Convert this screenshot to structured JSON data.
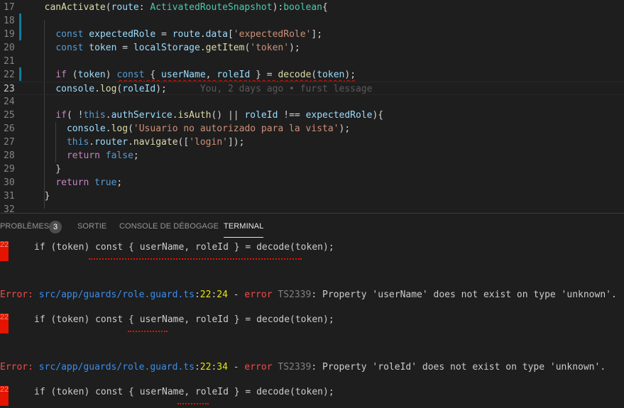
{
  "editor": {
    "lines": [
      {
        "num": "17",
        "tokens": [
          [
            "",
            "  "
          ],
          [
            "f",
            "canActivate"
          ],
          [
            "",
            "("
          ],
          [
            "v",
            "route"
          ],
          [
            "",
            ": "
          ],
          [
            "t",
            "ActivatedRouteSnapshot"
          ],
          [
            "",
            "):"
          ],
          [
            "t",
            "boolean"
          ],
          [
            "",
            "{"
          ]
        ]
      },
      {
        "num": "18",
        "tokens": []
      },
      {
        "num": "19",
        "tokens": [
          [
            "",
            "    "
          ],
          [
            "k",
            "const"
          ],
          [
            "",
            " "
          ],
          [
            "v",
            "expectedRole"
          ],
          [
            "",
            " = "
          ],
          [
            "v",
            "route"
          ],
          [
            "",
            "."
          ],
          [
            "v",
            "data"
          ],
          [
            "",
            "["
          ],
          [
            "s",
            "'expectedRole'"
          ],
          [
            "",
            "];"
          ]
        ]
      },
      {
        "num": "20",
        "tokens": [
          [
            "",
            "    "
          ],
          [
            "k",
            "const"
          ],
          [
            "",
            " "
          ],
          [
            "v",
            "token"
          ],
          [
            "",
            " = "
          ],
          [
            "v",
            "localStorage"
          ],
          [
            "",
            "."
          ],
          [
            "f",
            "getItem"
          ],
          [
            "",
            "("
          ],
          [
            "s",
            "'token'"
          ],
          [
            "",
            ");"
          ]
        ]
      },
      {
        "num": "21",
        "tokens": []
      },
      {
        "num": "22",
        "tokens": [
          [
            "",
            "    "
          ],
          [
            "kc",
            "if"
          ],
          [
            "",
            " ("
          ],
          [
            "v",
            "token"
          ],
          [
            "",
            ") "
          ],
          [
            "k sq",
            "const"
          ],
          [
            "sq",
            " { "
          ],
          [
            "v sq",
            "userName"
          ],
          [
            "sq",
            ", "
          ],
          [
            "v sq",
            "roleId"
          ],
          [
            "sq",
            " } = "
          ],
          [
            "f sq",
            "decode"
          ],
          [
            "sq",
            "("
          ],
          [
            "v sq",
            "token"
          ],
          [
            "sq",
            ");"
          ]
        ]
      },
      {
        "num": "23",
        "tokens": [
          [
            "",
            "    "
          ],
          [
            "v",
            "console"
          ],
          [
            "",
            "."
          ],
          [
            "f",
            "log"
          ],
          [
            "",
            "("
          ],
          [
            "v",
            "roleId"
          ],
          [
            "",
            ");"
          ],
          [
            "blame",
            "      You, 2 days ago • furst lessage"
          ]
        ]
      },
      {
        "num": "24",
        "tokens": []
      },
      {
        "num": "25",
        "tokens": [
          [
            "",
            "    "
          ],
          [
            "kc",
            "if"
          ],
          [
            "",
            "( !"
          ],
          [
            "k",
            "this"
          ],
          [
            "",
            "."
          ],
          [
            "v",
            "authService"
          ],
          [
            "",
            "."
          ],
          [
            "f",
            "isAuth"
          ],
          [
            "",
            "() || "
          ],
          [
            "v",
            "roleId"
          ],
          [
            "",
            " !== "
          ],
          [
            "v",
            "expectedRole"
          ],
          [
            "",
            "){"
          ]
        ]
      },
      {
        "num": "26",
        "tokens": [
          [
            "",
            "      "
          ],
          [
            "v",
            "console"
          ],
          [
            "",
            "."
          ],
          [
            "f",
            "log"
          ],
          [
            "",
            "("
          ],
          [
            "s",
            "'Usuario no autorizado para la vista'"
          ],
          [
            "",
            ");"
          ]
        ]
      },
      {
        "num": "27",
        "tokens": [
          [
            "",
            "      "
          ],
          [
            "k",
            "this"
          ],
          [
            "",
            "."
          ],
          [
            "v",
            "router"
          ],
          [
            "",
            "."
          ],
          [
            "f",
            "navigate"
          ],
          [
            "",
            "(["
          ],
          [
            "s",
            "'login'"
          ],
          [
            "",
            "]);"
          ]
        ]
      },
      {
        "num": "28",
        "tokens": [
          [
            "",
            "      "
          ],
          [
            "kc",
            "return"
          ],
          [
            "",
            " "
          ],
          [
            "k",
            "false"
          ],
          [
            "",
            ";"
          ]
        ]
      },
      {
        "num": "29",
        "tokens": [
          [
            "",
            "    }"
          ]
        ]
      },
      {
        "num": "30",
        "tokens": [
          [
            "",
            "    "
          ],
          [
            "kc",
            "return"
          ],
          [
            "",
            " "
          ],
          [
            "k",
            "true"
          ],
          [
            "",
            ";"
          ]
        ]
      },
      {
        "num": "31",
        "tokens": [
          [
            "",
            "  }"
          ]
        ]
      },
      {
        "num": "32",
        "tokens": []
      }
    ]
  },
  "panel": {
    "tabs": {
      "problems": "PROBLÈMES",
      "problems_count": "3",
      "output": "SORTIE",
      "debug_console": "CONSOLE DE DÉBOGAGE",
      "terminal": "TERMINAL"
    },
    "terminal": {
      "gutter_marker": "22",
      "code_line": "if (token) const { userName, roleId } = decode(token);",
      "error1": {
        "label": "Error:",
        "path": "src/app/guards/role.guard.ts",
        "sep1": ":",
        "line": "22",
        "sep2": ":",
        "col": "24",
        "dash": " - ",
        "kind": "error",
        "code": "TS2339",
        "message": ": Property 'userName' does not exist on type 'unknown'."
      },
      "error2": {
        "label": "Error:",
        "path": "src/app/guards/role.guard.ts",
        "sep1": ":",
        "line": "22",
        "sep2": ":",
        "col": "34",
        "dash": " - ",
        "kind": "error",
        "code": "TS2339",
        "message": ": Property 'roleId' does not exist on type 'unknown'."
      }
    }
  }
}
